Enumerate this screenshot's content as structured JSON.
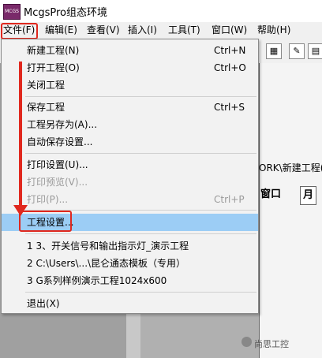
{
  "window": {
    "title": "McgsPro组态环境"
  },
  "menubar": {
    "items": [
      "文件(F)",
      "编辑(E)",
      "查看(V)",
      "插入(I)",
      "工具(T)",
      "窗口(W)",
      "帮助(H)"
    ]
  },
  "file_menu": {
    "items": [
      {
        "label": "新建工程(N)",
        "shortcut": "Ctrl+N",
        "enabled": true
      },
      {
        "label": "打开工程(O)",
        "shortcut": "Ctrl+O",
        "enabled": true
      },
      {
        "label": "关闭工程",
        "shortcut": "",
        "enabled": true
      },
      {
        "label": "保存工程",
        "shortcut": "Ctrl+S",
        "enabled": true
      },
      {
        "label": "工程另存为(A)...",
        "shortcut": "",
        "enabled": true
      },
      {
        "label": "自动保存设置...",
        "shortcut": "",
        "enabled": true
      },
      {
        "label": "打印设置(U)...",
        "shortcut": "",
        "enabled": true
      },
      {
        "label": "打印预览(V)...",
        "shortcut": "",
        "enabled": false
      },
      {
        "label": "打印(P)...",
        "shortcut": "Ctrl+P",
        "enabled": false
      },
      {
        "label": "工程设置...",
        "shortcut": "",
        "enabled": true,
        "highlighted": true
      },
      {
        "label": "1 3、开关信号和输出指示灯_演示工程",
        "shortcut": "",
        "enabled": true
      },
      {
        "label": "2 C:\\Users\\...\\昆仑通态模板（专用）",
        "shortcut": "",
        "enabled": true
      },
      {
        "label": "3 G系列样例演示工程1024x600",
        "shortcut": "",
        "enabled": true
      },
      {
        "label": "退出(X)",
        "shortcut": "",
        "enabled": true
      }
    ]
  },
  "background": {
    "path_text": "ORK\\新建工程(",
    "window_button": "窗口",
    "window_button_2": "月"
  },
  "watermark": {
    "text": "尚思工控"
  },
  "colors": {
    "highlight": "#9ccdf5",
    "annotation_red": "#e0281e"
  }
}
